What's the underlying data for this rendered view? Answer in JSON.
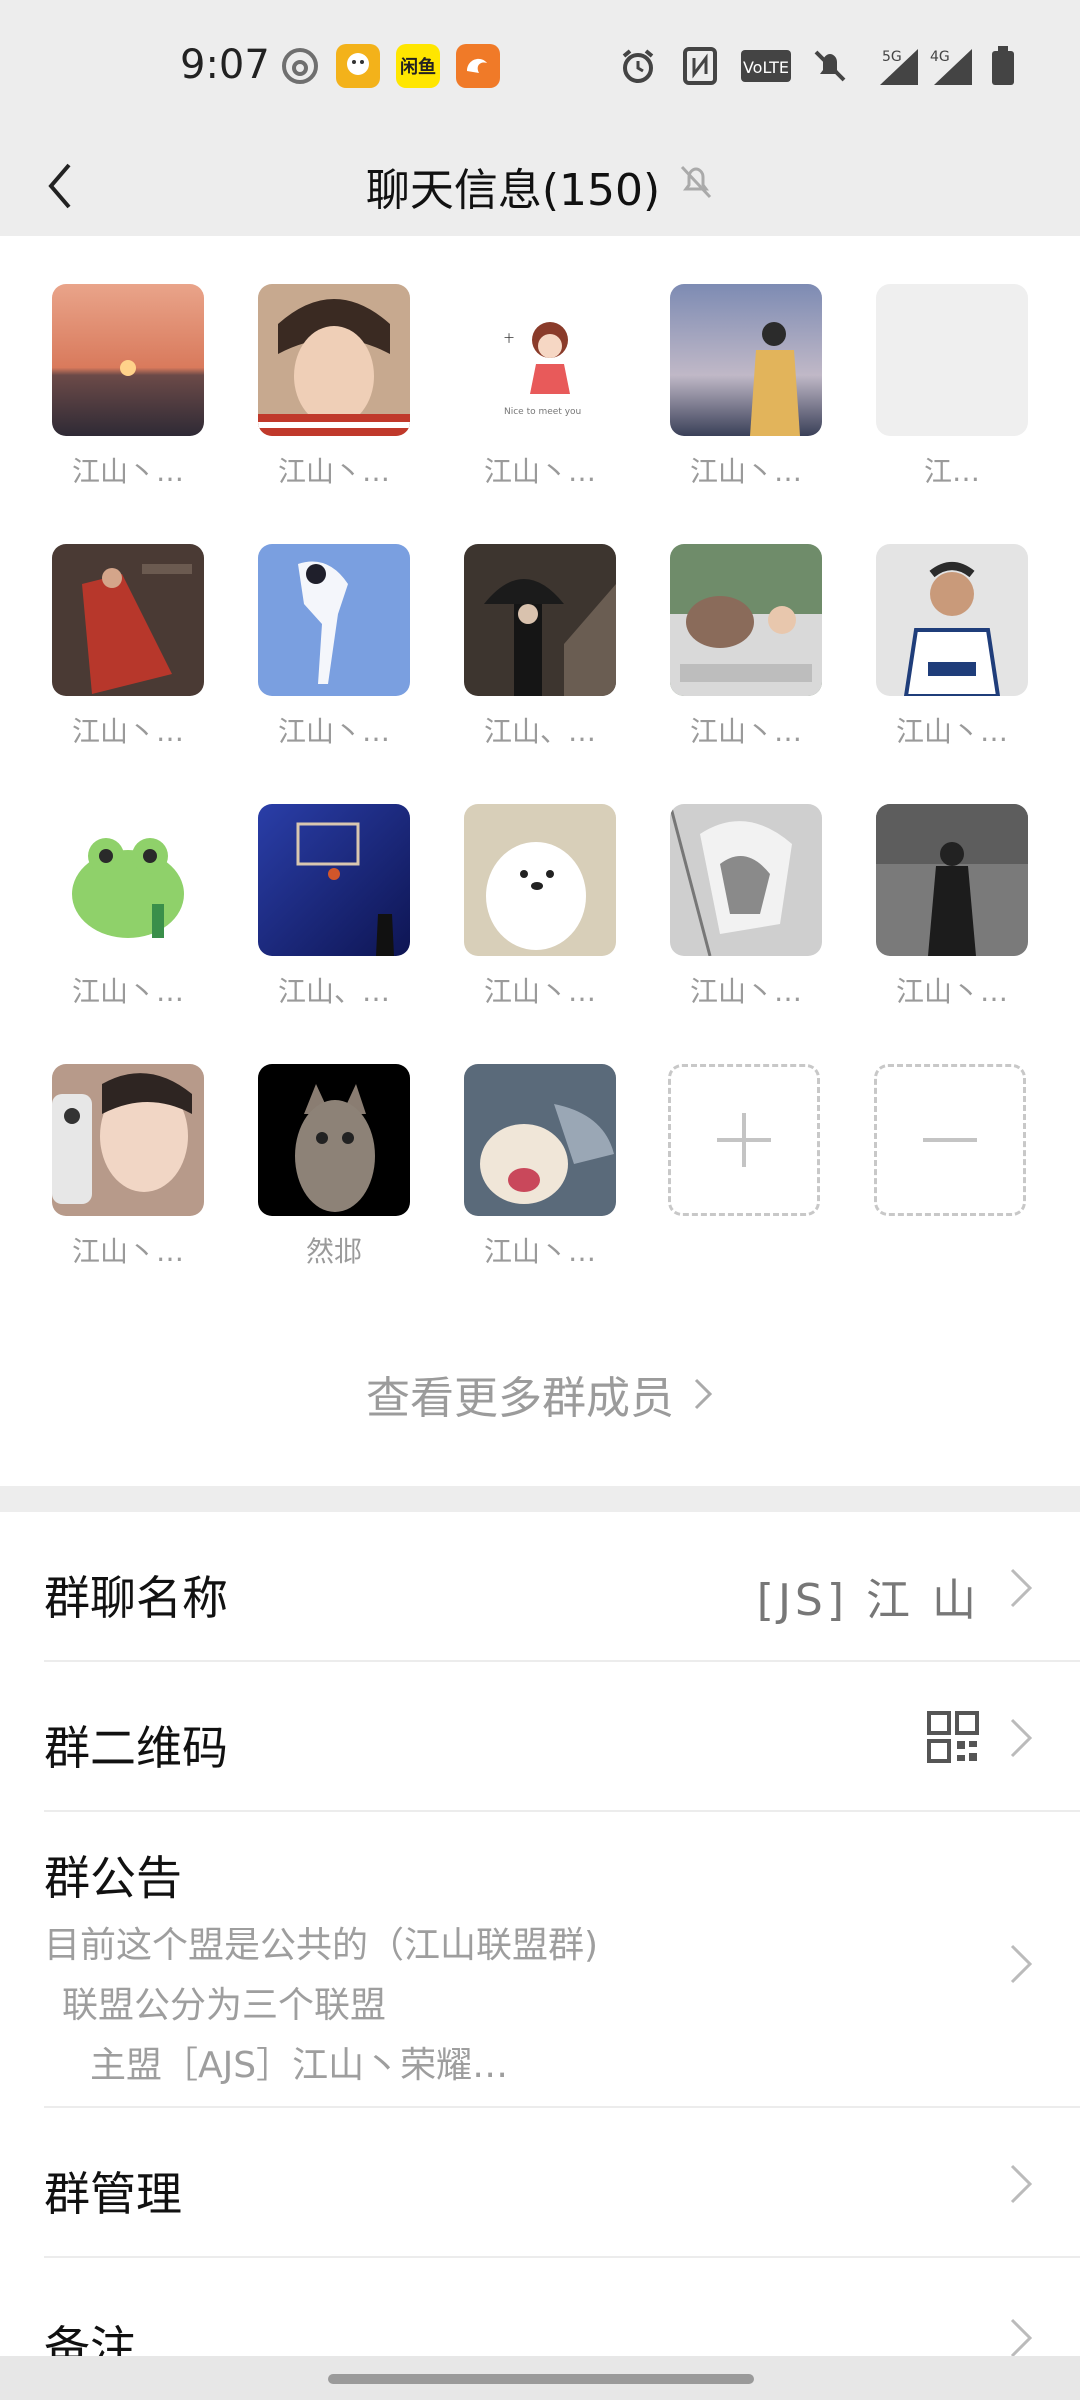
{
  "status_bar": {
    "time": "9:07",
    "app_icons": [
      {
        "name": "netease-music-icon",
        "color": "#6f6f6f"
      },
      {
        "name": "app-ad-icon",
        "color": "#f3b21a"
      },
      {
        "name": "xianyu-icon",
        "color": "#ffe600",
        "label": "闲鱼"
      },
      {
        "name": "uc-browser-icon",
        "color": "#f07a28"
      }
    ],
    "system_icons": [
      "alarm-icon",
      "nfc-icon",
      "volte-icon",
      "mute-icon",
      "signal-5g-icon",
      "signal-4g-icon",
      "battery-icon"
    ],
    "network": {
      "label_5g": "5G",
      "label_4g": "4G"
    }
  },
  "header": {
    "title": "聊天信息(150)"
  },
  "members": [
    {
      "name": "江山丶…",
      "avatar": "sunset"
    },
    {
      "name": "江山丶…",
      "avatar": "boy-face"
    },
    {
      "name": "江山丶…",
      "avatar": "cartoon-girl"
    },
    {
      "name": "江山丶…",
      "avatar": "sea-boy"
    },
    {
      "name": "江…",
      "avatar": "blank"
    },
    {
      "name": "江山丶…",
      "avatar": "red-dress"
    },
    {
      "name": "江山丶…",
      "avatar": "blue-dancer"
    },
    {
      "name": "江山、…",
      "avatar": "umbrella"
    },
    {
      "name": "江山丶…",
      "avatar": "dog-car"
    },
    {
      "name": "江山丶…",
      "avatar": "footballer"
    },
    {
      "name": "江山丶…",
      "avatar": "green-frog"
    },
    {
      "name": "江山、…",
      "avatar": "basketball"
    },
    {
      "name": "江山丶…",
      "avatar": "white-bear"
    },
    {
      "name": "江山丶…",
      "avatar": "anime-gray"
    },
    {
      "name": "江山丶…",
      "avatar": "street-man"
    },
    {
      "name": "江山丶…",
      "avatar": "phone-boy"
    },
    {
      "name": "然邶",
      "avatar": "cat"
    },
    {
      "name": "江山丶…",
      "avatar": "dog-shark"
    }
  ],
  "add_member_label": "",
  "remove_member_label": "",
  "view_more": "查看更多群成员",
  "settings": {
    "group_name_label": "群聊名称",
    "group_name_value": "[JS] 江 山",
    "qr_label": "群二维码",
    "notice_label": "群公告",
    "notice_lines": [
      "目前这个盟是公共的（江山联盟群)",
      "联盟公分为三个联盟",
      "主盟［AJS］江山丶荣耀…"
    ],
    "manage_label": "群管理",
    "remark_label": "备注"
  },
  "colors": {
    "header_bg": "#ededed",
    "muted_text": "#9a9a9a"
  }
}
